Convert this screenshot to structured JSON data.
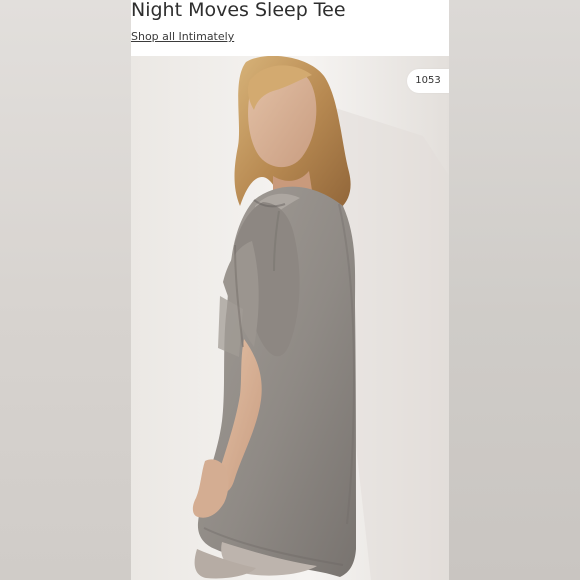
{
  "product": {
    "title": "Night Moves Sleep Tee",
    "shop_link": "Shop all Intimately"
  },
  "image": {
    "count_badge": "1053",
    "subject": "model wearing a grey oversized sleep tee"
  },
  "colors": {
    "tee": "#8e8984",
    "background": "#f1efec",
    "text": "#2e2e2e"
  }
}
